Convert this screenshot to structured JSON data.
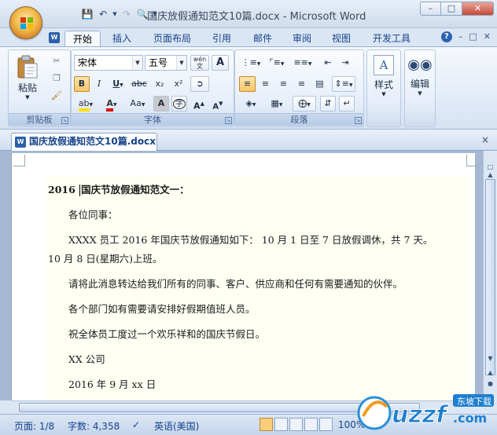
{
  "window": {
    "title": "国庆放假通知范文10篇.docx - Microsoft Word",
    "controls": {
      "minimize": "–",
      "maximize": "□",
      "close": "✕"
    }
  },
  "quick_access": [
    "save-icon",
    "undo-icon",
    "redo-icon",
    "print-preview-icon"
  ],
  "tabs": [
    {
      "label": "开始",
      "active": true
    },
    {
      "label": "插入"
    },
    {
      "label": "页面布局"
    },
    {
      "label": "引用"
    },
    {
      "label": "邮件"
    },
    {
      "label": "审阅"
    },
    {
      "label": "视图"
    },
    {
      "label": "开发工具"
    }
  ],
  "ribbon": {
    "clipboard": {
      "paste": "粘贴",
      "label": "剪贴板"
    },
    "font": {
      "font_name": "宋体",
      "font_size": "五号",
      "phonetic": "wén",
      "label": "字体",
      "bold": "B",
      "italic": "I",
      "underline": "U",
      "strike": "abc",
      "subscript": "x₂",
      "superscript": "x²",
      "aa": "Aa",
      "font_color_letter": "A"
    },
    "paragraph": {
      "label": "段落"
    },
    "styles": {
      "label": "样式"
    },
    "editing": {
      "label": "编辑"
    }
  },
  "document_tab": {
    "title": "国庆放假通知范文10篇.docx",
    "close": "×"
  },
  "document": {
    "lines": [
      "2016 ",
      "国庆节放假通知范文一：",
      "各位同事：",
      "XXXX 员工 2016 年国庆节放假通知如下： 10 月 1 日至 7 日放假调休，共 7 天。",
      "10 月 8 日(星期六)上班。",
      "请将此消息转达给我们所有的同事、客户、供应商和任何有需要通知的伙伴。",
      "各个部门如有需要请安排好假期值班人员。",
      "祝全体员工度过一个欢乐祥和的国庆节假日。",
      "XX 公司",
      "2016 年 9 月 xx 日"
    ]
  },
  "status_bar": {
    "page": "页面: 1/8",
    "words": "字数: 4,358",
    "language": "英语(美国)",
    "zoom": "100%"
  },
  "watermark": {
    "text": "uzzf.com",
    "subtext": "东坡下载"
  },
  "colors": {
    "accent": "#15428b",
    "office_orb": "#f1b94a",
    "active_button": "#fbc567",
    "page_tint": "#fffff4"
  }
}
